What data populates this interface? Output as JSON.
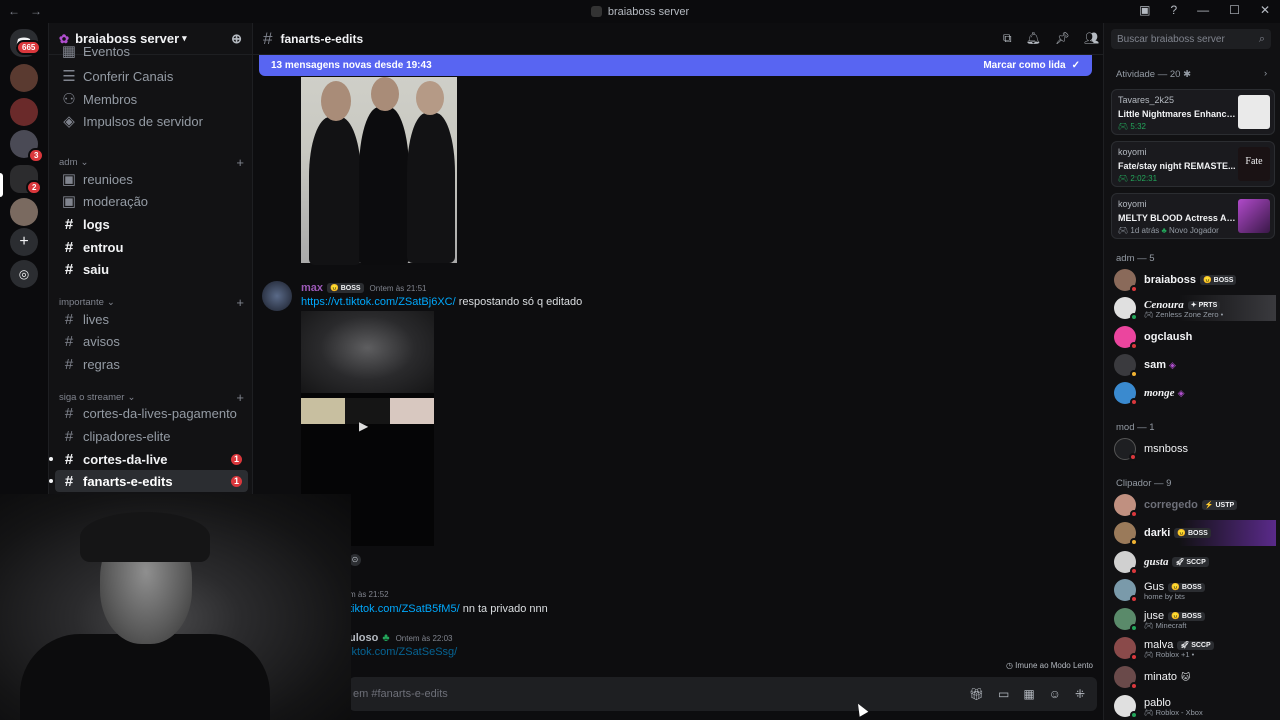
{
  "window": {
    "title": "braiaboss server"
  },
  "rail": {
    "badges": [
      "665",
      "3",
      "2"
    ]
  },
  "server": {
    "name": "braiaboss server"
  },
  "channels": {
    "top_items": [
      "Eventos",
      "Conferir Canais",
      "Membros",
      "Impulsos de servidor"
    ],
    "categories": [
      {
        "name": "adm",
        "items": [
          "reunioes",
          "moderação",
          "logs",
          "entrou",
          "saiu"
        ]
      },
      {
        "name": "importante",
        "items": [
          "lives",
          "avisos",
          "regras"
        ]
      },
      {
        "name": "siga o streamer",
        "items": [
          "cortes-da-lives-pagamento",
          "clipadores-elite",
          "cortes-da-live",
          "fanarts-e-edits"
        ]
      }
    ],
    "unread_counts": {
      "cortes_da_live": "1",
      "fanarts_e_edits": "1"
    }
  },
  "header": {
    "channel": "fanarts-e-edits",
    "search_placeholder": "Buscar braiaboss server"
  },
  "new_messages": {
    "text": "13 mensagens novas desde 19:43",
    "action": "Marcar como lida"
  },
  "messages": [
    {
      "author": "max",
      "role": "BOSS",
      "time": "Ontem às 21:51",
      "link": "https://vt.tiktok.com/ZSatBj6XC/",
      "text": " respostando só q editado"
    },
    {
      "time_partial": "m às 21:52",
      "link": "tiktok.com/ZSatB5fM5/",
      "text": " nn ta privado nnn"
    },
    {
      "author_partial": "uloso",
      "time": "Ontem às 22:03",
      "link": "iktok.com/ZSatSeSsg/"
    }
  ],
  "composer": {
    "placeholder": "em #fanarts-e-edits",
    "slowmode": "Imune ao Modo Lento"
  },
  "activity": {
    "header": "Atividade — 20",
    "cards": [
      {
        "user": "Tavares_2k25",
        "game": "Little Nightmares Enhance...",
        "time": "5:32"
      },
      {
        "user": "koyomi",
        "game": "Fate/stay night REMASTE...",
        "time": "2:02:31"
      },
      {
        "user": "koyomi",
        "game": "MELTY BLOOD Actress Ag...",
        "time": "1d atrás",
        "extra": "Novo Jogador"
      }
    ]
  },
  "member_groups": [
    {
      "label": "adm — 5",
      "members": [
        {
          "name": "braiaboss",
          "tag": "BOSS"
        },
        {
          "name": "Cenoura",
          "tag": "PRTS",
          "sub": "Zenless Zone Zero •"
        },
        {
          "name": "ogclaush"
        },
        {
          "name": "sam"
        },
        {
          "name": "monge"
        }
      ]
    },
    {
      "label": "mod — 1",
      "members": [
        {
          "name": "msnboss"
        }
      ]
    },
    {
      "label": "Clipador — 9",
      "members": [
        {
          "name": "corregedo",
          "tag": "USTP"
        },
        {
          "name": "darki",
          "tag": "BOSS"
        },
        {
          "name": "gusta",
          "tag": "SCCP"
        },
        {
          "name": "Gus",
          "tag": "BOSS",
          "sub": "home by bts"
        },
        {
          "name": "juse",
          "tag": "BOSS",
          "sub": "Minecraft"
        },
        {
          "name": "malva",
          "tag": "SCCP",
          "sub": "Roblox +1 •"
        },
        {
          "name": "minato"
        },
        {
          "name": "pablo",
          "sub": "Roblox - Xbox"
        }
      ]
    }
  ],
  "colors": {
    "accent": "#5865f2",
    "danger": "#da373c",
    "online": "#23a55a",
    "link": "#00a8fc"
  }
}
